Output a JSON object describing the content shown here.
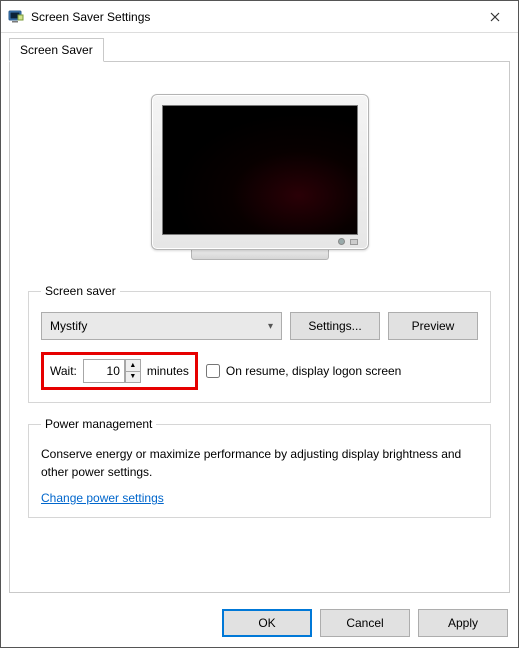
{
  "window": {
    "title": "Screen Saver Settings"
  },
  "tab": {
    "label": "Screen Saver"
  },
  "screensaver_group": {
    "legend": "Screen saver",
    "selected": "Mystify",
    "settings_btn": "Settings...",
    "preview_btn": "Preview",
    "wait_label": "Wait:",
    "wait_value": "10",
    "wait_unit": "minutes",
    "resume_label": "On resume, display logon screen",
    "resume_checked": false
  },
  "power_group": {
    "legend": "Power management",
    "text": "Conserve energy or maximize performance by adjusting display brightness and other power settings.",
    "link": "Change power settings"
  },
  "buttons": {
    "ok": "OK",
    "cancel": "Cancel",
    "apply": "Apply"
  }
}
